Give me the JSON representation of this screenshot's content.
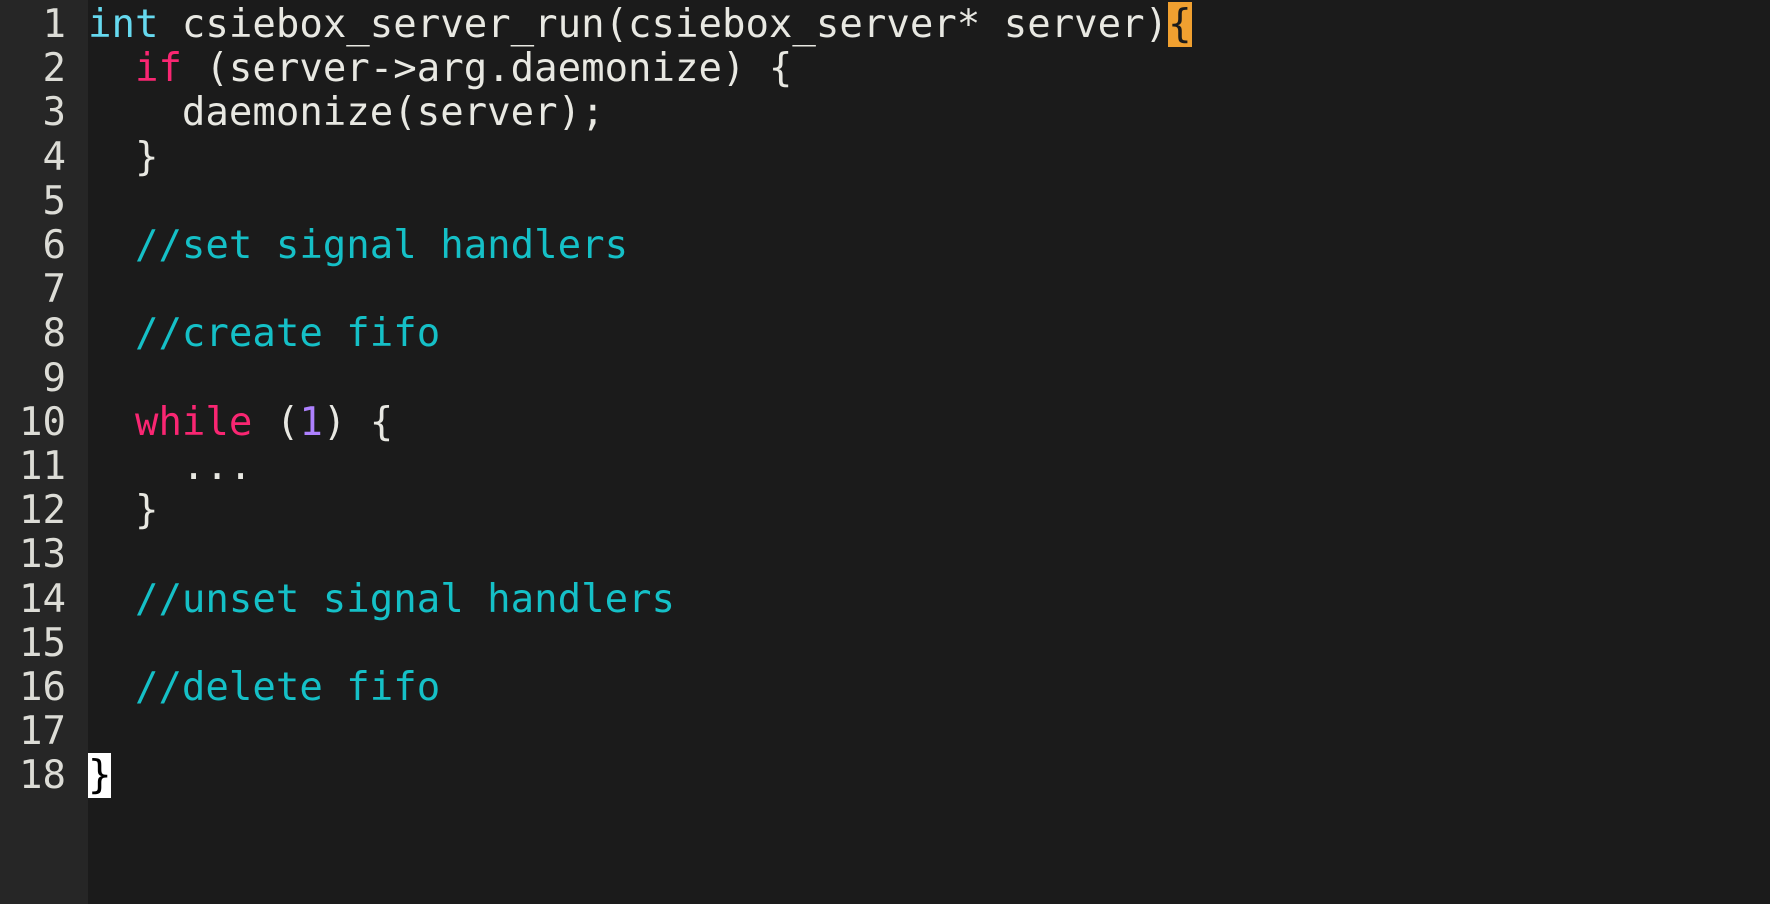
{
  "editor": {
    "lines": [
      {
        "num": "1",
        "tokens": [
          {
            "cls": "kw-type",
            "text": "int"
          },
          {
            "cls": "plain",
            "text": " csiebox_server_run(csiebox_server* server)"
          },
          {
            "cls": "bracket-hl",
            "text": "{"
          }
        ]
      },
      {
        "num": "2",
        "tokens": [
          {
            "cls": "plain",
            "text": "  "
          },
          {
            "cls": "kw",
            "text": "if"
          },
          {
            "cls": "plain",
            "text": " (server->arg.daemonize) {"
          }
        ]
      },
      {
        "num": "3",
        "tokens": [
          {
            "cls": "plain",
            "text": "    daemonize(server);"
          }
        ]
      },
      {
        "num": "4",
        "tokens": [
          {
            "cls": "plain",
            "text": "  }"
          }
        ]
      },
      {
        "num": "5",
        "tokens": []
      },
      {
        "num": "6",
        "tokens": [
          {
            "cls": "plain",
            "text": "  "
          },
          {
            "cls": "cmt",
            "text": "//set signal handlers"
          }
        ]
      },
      {
        "num": "7",
        "tokens": []
      },
      {
        "num": "8",
        "tokens": [
          {
            "cls": "plain",
            "text": "  "
          },
          {
            "cls": "cmt",
            "text": "//create fifo"
          }
        ]
      },
      {
        "num": "9",
        "tokens": []
      },
      {
        "num": "10",
        "tokens": [
          {
            "cls": "plain",
            "text": "  "
          },
          {
            "cls": "kw",
            "text": "while"
          },
          {
            "cls": "plain",
            "text": " ("
          },
          {
            "cls": "num",
            "text": "1"
          },
          {
            "cls": "plain",
            "text": ") {"
          }
        ]
      },
      {
        "num": "11",
        "tokens": [
          {
            "cls": "plain",
            "text": "    ..."
          }
        ]
      },
      {
        "num": "12",
        "tokens": [
          {
            "cls": "plain",
            "text": "  }"
          }
        ]
      },
      {
        "num": "13",
        "tokens": []
      },
      {
        "num": "14",
        "tokens": [
          {
            "cls": "plain",
            "text": "  "
          },
          {
            "cls": "cmt",
            "text": "//unset signal handlers"
          }
        ]
      },
      {
        "num": "15",
        "tokens": []
      },
      {
        "num": "16",
        "tokens": [
          {
            "cls": "plain",
            "text": "  "
          },
          {
            "cls": "cmt",
            "text": "//delete fifo"
          }
        ]
      },
      {
        "num": "17",
        "tokens": []
      },
      {
        "num": "18",
        "tokens": [
          {
            "cls": "cursor-block",
            "text": "}"
          }
        ]
      }
    ],
    "colors": {
      "background": "#1b1b1b",
      "gutter": "#262626",
      "type_keyword": "#66d9ef",
      "keyword": "#f92672",
      "number": "#ae81ff",
      "comment": "#15c0c7",
      "text": "#e8e8e2",
      "bracket_highlight": "#f0a030",
      "cursor": "#ffffff"
    }
  }
}
